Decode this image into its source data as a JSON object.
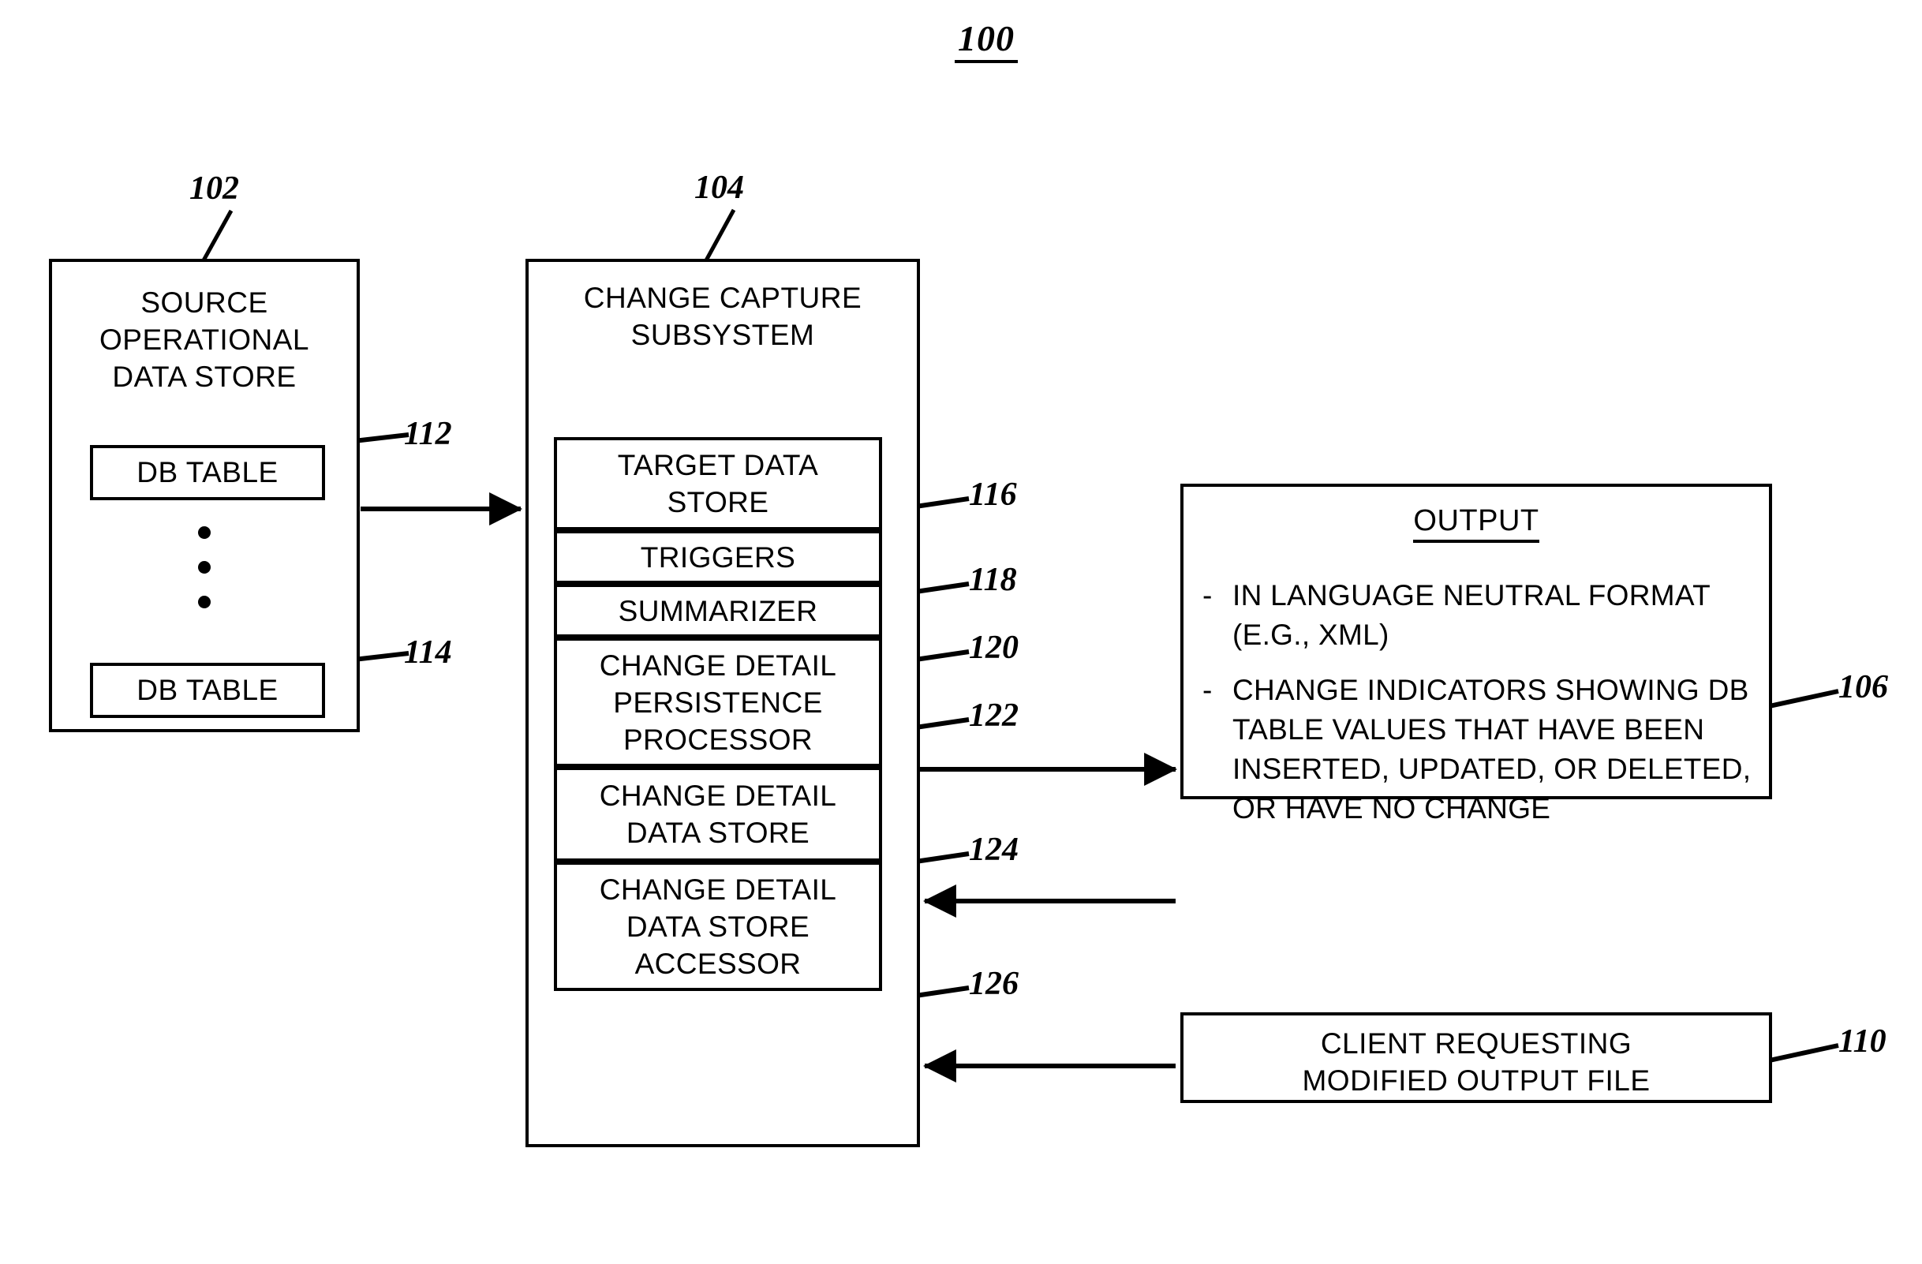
{
  "figure": {
    "number": "100"
  },
  "source_store": {
    "ref": "102",
    "title_line1": "SOURCE",
    "title_line2": "OPERATIONAL",
    "title_line3": "DATA STORE",
    "tables": [
      {
        "label": "DB TABLE",
        "ref": "112"
      },
      {
        "label": "DB TABLE",
        "ref": "114"
      }
    ],
    "ellipsis_dots": 3
  },
  "change_capture_subsystem": {
    "ref": "104",
    "title_line1": "CHANGE CAPTURE",
    "title_line2": "SUBSYSTEM",
    "components": [
      {
        "ref": "116",
        "lines": [
          "TARGET DATA",
          "STORE"
        ]
      },
      {
        "ref": "118",
        "lines": [
          "TRIGGERS"
        ]
      },
      {
        "ref": "120",
        "lines": [
          "SUMMARIZER"
        ]
      },
      {
        "ref": "122",
        "lines": [
          "CHANGE DETAIL",
          "PERSISTENCE",
          "PROCESSOR"
        ]
      },
      {
        "ref": "124",
        "lines": [
          "CHANGE DETAIL",
          "DATA STORE"
        ]
      },
      {
        "ref": "126",
        "lines": [
          "CHANGE DETAIL",
          "DATA STORE",
          "ACCESSOR"
        ]
      }
    ]
  },
  "output": {
    "ref": "106",
    "heading": "OUTPUT",
    "bullets": [
      {
        "marker": "-",
        "text": "IN LANGUAGE NEUTRAL FORMAT (E.G., XML)"
      },
      {
        "marker": "-",
        "text": "CHANGE INDICATORS SHOWING DB TABLE VALUES THAT HAVE BEEN INSERTED, UPDATED, OR DELETED, OR HAVE NO CHANGE"
      }
    ]
  },
  "client": {
    "ref": "110",
    "line1": "CLIENT REQUESTING",
    "line2": "MODIFIED OUTPUT FILE"
  }
}
